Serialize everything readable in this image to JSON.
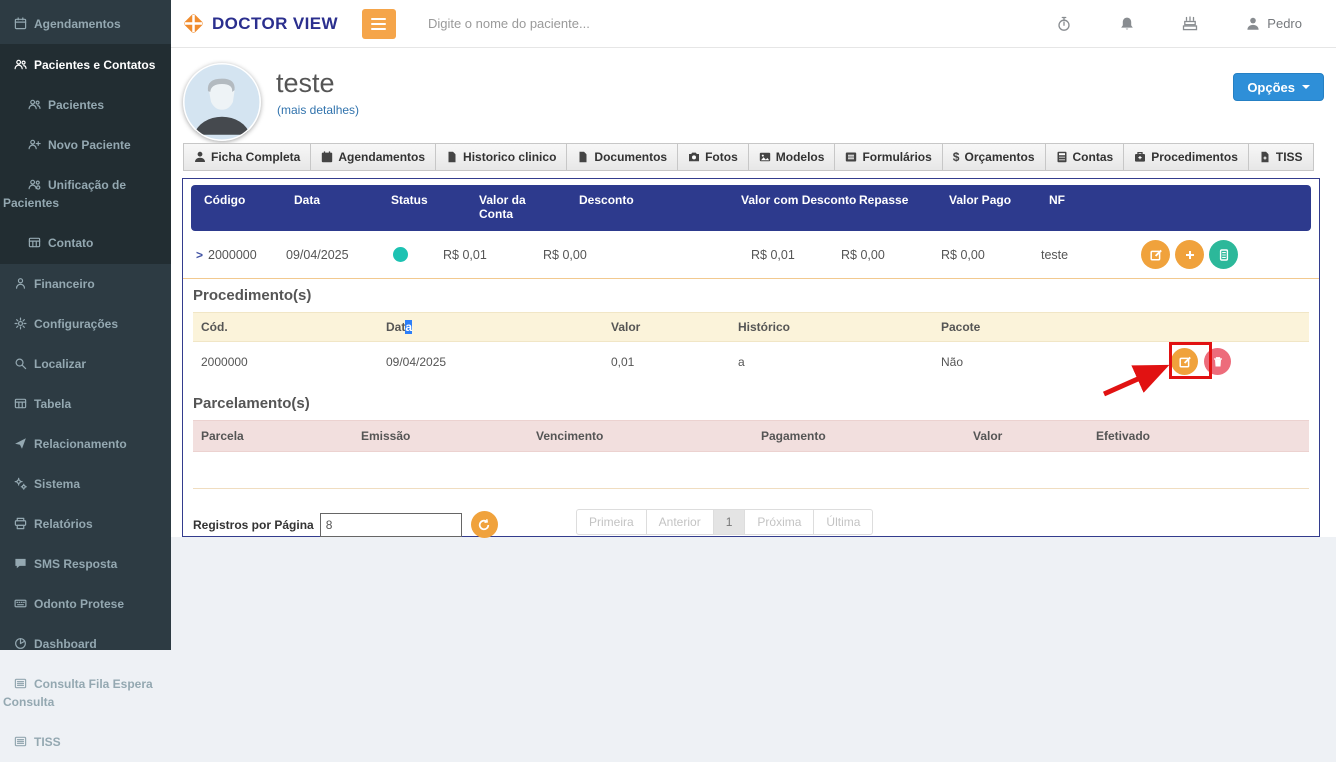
{
  "topbar": {
    "brand": "DOCTOR VIEW",
    "search_placeholder": "Digite o nome do paciente...",
    "user_name": "Pedro",
    "icons": [
      "stopwatch-icon",
      "bell-icon",
      "cake-icon",
      "user-icon"
    ]
  },
  "sidebar": {
    "items": [
      {
        "label": "Agendamentos",
        "icon": "calendar-icon"
      },
      {
        "label": "Pacientes e Contatos",
        "icon": "users-icon",
        "active": true
      },
      {
        "label": "Pacientes",
        "icon": "users-icon",
        "sub": true
      },
      {
        "label": "Novo Paciente",
        "icon": "user-plus-icon",
        "sub": true
      },
      {
        "label": "Unificação de Pacientes",
        "icon": "users-gear-icon",
        "sub": true
      },
      {
        "label": "Contato",
        "icon": "table-icon",
        "sub": true
      },
      {
        "label": "Financeiro",
        "icon": "user-money-icon"
      },
      {
        "label": "Configurações",
        "icon": "gear-icon"
      },
      {
        "label": "Localizar",
        "icon": "search-icon"
      },
      {
        "label": "Tabela",
        "icon": "table-icon"
      },
      {
        "label": "Relacionamento",
        "icon": "paper-plane-icon"
      },
      {
        "label": "Sistema",
        "icon": "gears-icon"
      },
      {
        "label": "Relatórios",
        "icon": "printer-icon"
      },
      {
        "label": "SMS Resposta",
        "icon": "comment-icon"
      },
      {
        "label": "Odonto Protese",
        "icon": "keyboard-icon"
      },
      {
        "label": "Dashboard",
        "icon": "pie-chart-icon"
      },
      {
        "label": "Consulta Fila Espera Consulta",
        "icon": "list-icon"
      },
      {
        "label": "TISS",
        "icon": "list-icon"
      }
    ]
  },
  "patient": {
    "name": "teste",
    "more_details": "(mais detalhes)",
    "options_button": "Opções"
  },
  "tabs": [
    "Ficha Completa",
    "Agendamentos",
    "Historico clinico",
    "Documentos",
    "Fotos",
    "Modelos",
    "Formulários",
    "Orçamentos",
    "Contas",
    "Procedimentos",
    "TISS"
  ],
  "accounts": {
    "expander_glyph": ">",
    "columns": [
      "Código",
      "Data",
      "Status",
      "Valor da Conta",
      "Desconto",
      "Valor com Desconto",
      "Repasse",
      "Valor Pago",
      "NF"
    ],
    "row": {
      "codigo": "2000000",
      "data": "09/04/2025",
      "status_color": "#1dc2b2",
      "valor_da_conta": "R$ 0,01",
      "desconto": "R$ 0,00",
      "valor_com_desconto": "R$ 0,01",
      "repasse": "R$ 0,00",
      "valor_pago": "R$ 0,00",
      "nf": "teste"
    },
    "row_actions": [
      "edit-icon",
      "plus-icon",
      "calculator-icon"
    ]
  },
  "procedures": {
    "title": "Procedimento(s)",
    "columns": {
      "c1": "Cód.",
      "c2_pre": "Dat",
      "c2_selected": "a",
      "c3": "Valor",
      "c4": "Histórico",
      "c5": "Pacote"
    },
    "row": {
      "cod": "2000000",
      "data": "09/04/2025",
      "valor": "0,01",
      "historico": "a",
      "pacote": "Não"
    },
    "row_actions": [
      "edit-icon",
      "trash-icon"
    ]
  },
  "installments": {
    "title": "Parcelamento(s)",
    "columns": [
      "Parcela",
      "Emissão",
      "Vencimento",
      "Pagamento",
      "Valor",
      "Efetivado"
    ]
  },
  "footer": {
    "records_label": "Registros por Página",
    "records_value": "8",
    "pagination": [
      "Primeira",
      "Anterior",
      "1",
      "Próxima",
      "Última"
    ]
  },
  "colors": {
    "sidebar_bg": "#2d3b43",
    "sidebar_active_bg": "#222d32",
    "accent_orange": "#f0a23c",
    "table_header_blue": "#2d3a8d",
    "status_teal": "#1dc2b2",
    "primary_blue": "#2e8fd8",
    "action_green": "#2cb89a",
    "action_red": "#ed6c7b",
    "procedures_header_bg": "#fbf3da",
    "installments_header_bg": "#f2dfde",
    "annotation_red": "#e11212"
  }
}
